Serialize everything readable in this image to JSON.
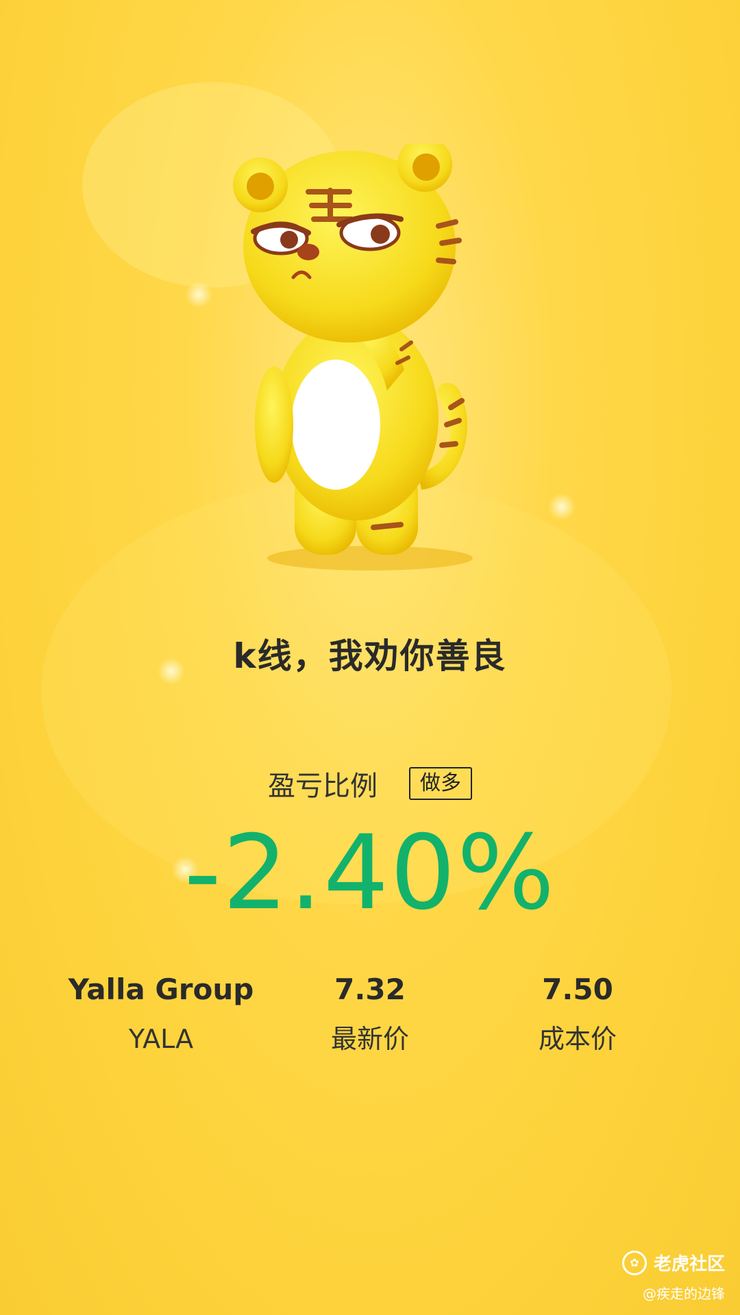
{
  "headline": "k线，我劝你善良",
  "ratio": {
    "label": "盈亏比例",
    "direction": "做多",
    "percent": "-2.40%",
    "percent_color": "#12b26c"
  },
  "stock": {
    "name": "Yalla Group",
    "ticker": "YALA",
    "latest_price": "7.32",
    "latest_price_label": "最新价",
    "cost_price": "7.50",
    "cost_price_label": "成本价"
  },
  "watermark": {
    "brand": "老虎社区",
    "user": "@疾走的边锋"
  },
  "icons": {
    "mascot": "tiger-mascot",
    "brand_logo": "tiger-brokers-logo"
  },
  "colors": {
    "background": "#fdd23a",
    "text": "#2a2a2a"
  }
}
